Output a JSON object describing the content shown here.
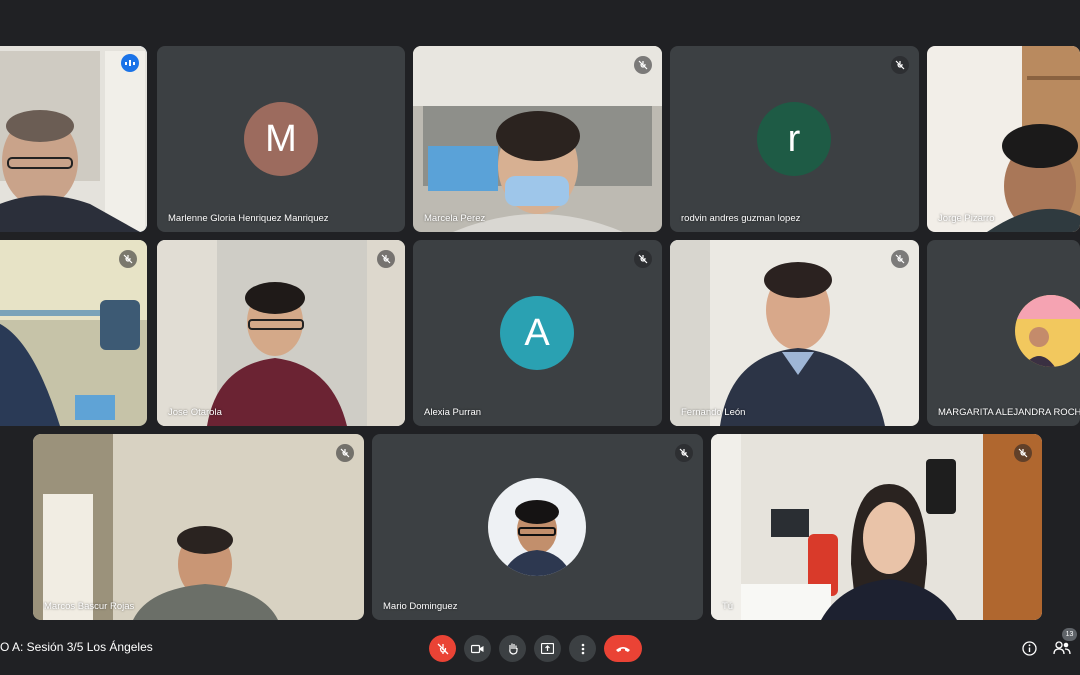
{
  "tiles": {
    "t1": {
      "name": ""
    },
    "t2": {
      "name": "Marlenne Gloria Henriquez Manriquez",
      "initial": "M",
      "color": "#9c6b5e"
    },
    "t3": {
      "name": "Marcela Perez"
    },
    "t4": {
      "name": "rodvin andres guzman lopez",
      "initial": "r",
      "color": "#1e5b45"
    },
    "t5": {
      "name": "Jorge Pizarro"
    },
    "t6": {
      "name": ""
    },
    "t7": {
      "name": "Jose Otarola"
    },
    "t8": {
      "name": "Alexia Purran",
      "initial": "A",
      "color": "#2aa1b2"
    },
    "t9": {
      "name": "Fernando León"
    },
    "t10": {
      "name": "MARGARITA ALEJANDRA ROCH"
    },
    "t11": {
      "name": "Marcos Bascur Rojas"
    },
    "t12": {
      "name": "Mario Dominguez"
    },
    "t13": {
      "name": "Tú"
    }
  },
  "meeting": {
    "title": "O A: Sesión 3/5 Los Ángeles"
  },
  "participants_count": "13",
  "colors": {
    "accent": "#8ab4f8",
    "danger": "#ea4335",
    "tile": "#3c4043"
  },
  "icons": [
    "mic-off-icon",
    "camera-icon",
    "raise-hand-icon",
    "present-screen-icon",
    "more-options-icon",
    "end-call-icon",
    "info-icon",
    "people-icon"
  ]
}
